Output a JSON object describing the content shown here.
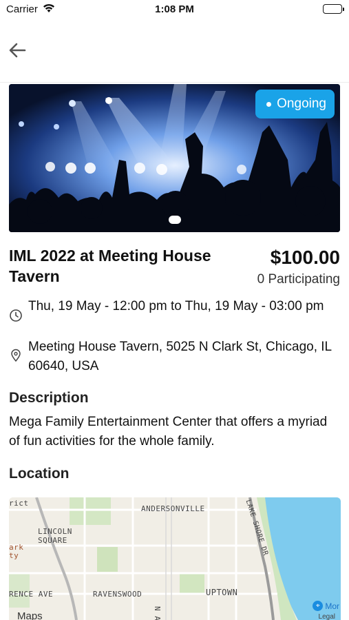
{
  "status_bar": {
    "carrier": "Carrier",
    "time": "1:08 PM"
  },
  "nav": {
    "back_icon": "arrow-left-icon"
  },
  "hero": {
    "status_badge": "Ongoing",
    "status_color": "#1aa3e8",
    "image_description_icon": "concert-photo"
  },
  "event": {
    "title": "IML 2022 at Meeting House Tavern",
    "price": "$100.00",
    "participating": "0 Participating",
    "datetime": "Thu, 19 May - 12:00 pm to Thu, 19 May - 03:00 pm",
    "address": "Meeting House Tavern, 5025 N Clark St, Chicago, IL 60640, USA"
  },
  "sections": {
    "description_heading": "Description",
    "description_text": "Mega Family Entertainment Center that offers a myriad of fun activities for the whole family.",
    "location_heading": "Location"
  },
  "map": {
    "labels": {
      "district": "rict",
      "andersonville": "ANDERSONVILLE",
      "lincoln": "LINCOLN",
      "square": "SQUARE",
      "ark": "ark",
      "ty": "ty",
      "rence_ave": "RENCE AVE",
      "ravenswood": "RAVENSWOOD",
      "ashla": "N ASHLA",
      "uptown": "UPTOWN",
      "lake_shore": "LAKE SHORE DR"
    },
    "maps_logo": "Maps",
    "more_link": "Mor",
    "legal": "Legal"
  }
}
